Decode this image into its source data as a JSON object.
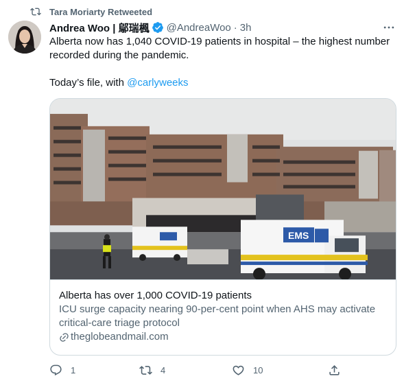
{
  "retweet_banner": {
    "text": "Tara Moriarty Retweeted"
  },
  "tweet": {
    "author_name": "Andrea Woo | 鄔瑞楓",
    "handle": "@AndreaWoo",
    "separator": "·",
    "time": "3h",
    "text_main": "Alberta now has 1,040 COVID-19 patients in hospital – the highest number recorded during the pandemic.\n\nToday’s file, with ",
    "mention": "@carlyweeks"
  },
  "card": {
    "title": "Alberta has over 1,000 COVID-19 patients",
    "description": "ICU surge capacity nearing 90-per-cent point when AHS may activate critical-care triage protocol",
    "domain": "theglobeandmail.com",
    "image_sign": "EMS"
  },
  "actions": {
    "reply_count": "1",
    "retweet_count": "4",
    "like_count": "10"
  },
  "colors": {
    "accent": "#1d9bf0",
    "secondary_text": "#536471",
    "border": "#cfd9de"
  },
  "icons": [
    "retweet-icon",
    "verified-icon",
    "more-icon",
    "link-icon",
    "reply-icon",
    "like-icon",
    "share-icon"
  ]
}
